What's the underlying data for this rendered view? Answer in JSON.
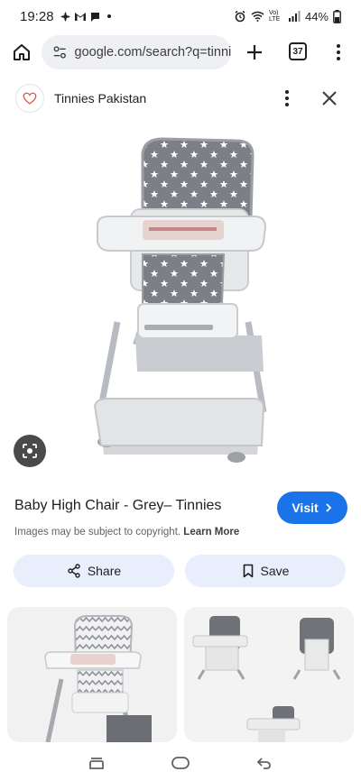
{
  "status_bar": {
    "time": "19:28",
    "battery": "44%",
    "network_label": "Vo) LTE"
  },
  "browser": {
    "url": "google.com/search?q=tinnies",
    "tab_count": "37"
  },
  "source": {
    "name": "Tinnies Pakistan"
  },
  "result": {
    "title": "Baby High Chair - Grey– Tinnies",
    "visit_label": "Visit",
    "copyright_text": "Images may be subject to copyright. ",
    "learn_more_label": "Learn More"
  },
  "actions": {
    "share_label": "Share",
    "save_label": "Save"
  },
  "colors": {
    "accent": "#1a73e8",
    "pill_bg": "#e8eefb",
    "url_bg": "#eef0f4"
  },
  "icons": {
    "home": "home-icon",
    "plus": "plus-icon",
    "menu": "more-vertical-icon",
    "close": "close-icon",
    "lens": "lens-icon",
    "share": "share-icon",
    "save": "bookmark-icon",
    "chevron": "chevron-right-icon"
  }
}
